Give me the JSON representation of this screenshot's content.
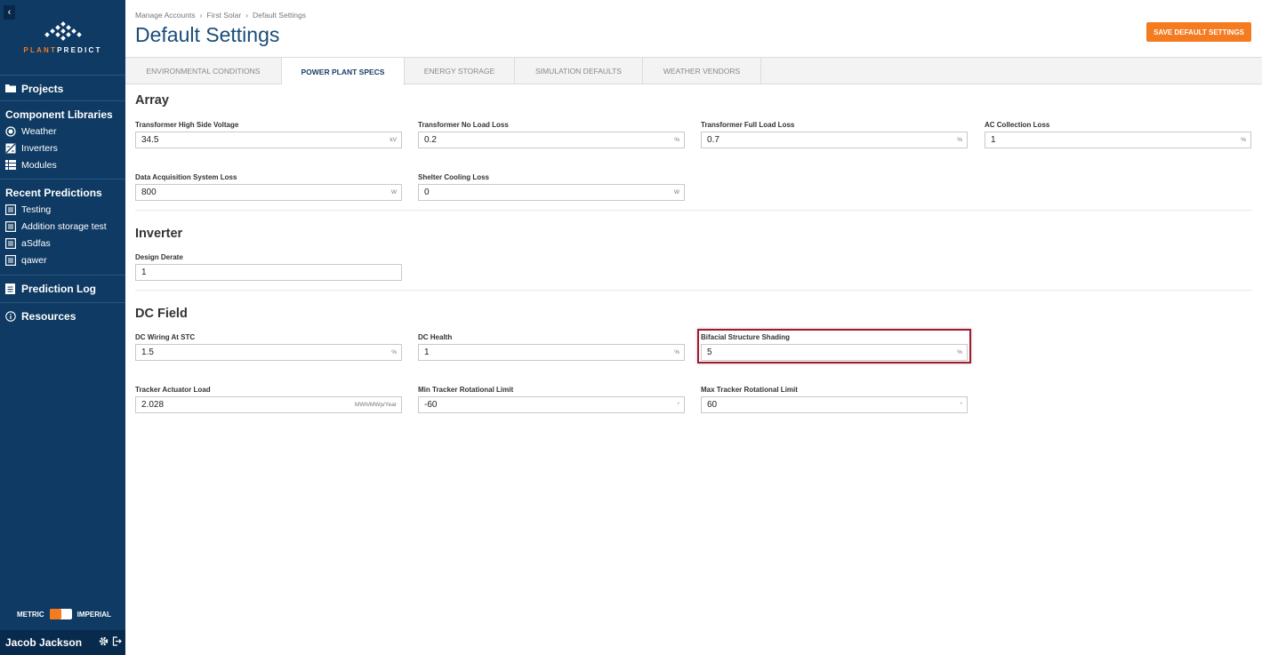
{
  "sidebar": {
    "collapse_glyph": "‹",
    "logo": {
      "plant": "PLANT",
      "predict": "PREDICT"
    },
    "projects": "Projects",
    "component_libraries": "Component Libraries",
    "libraries": [
      "Weather",
      "Inverters",
      "Modules"
    ],
    "recent_predictions": "Recent Predictions",
    "recent": [
      "Testing",
      "Addition storage test",
      "aSdfas",
      "qawer"
    ],
    "prediction_log": "Prediction Log",
    "resources": "Resources",
    "units": {
      "metric": "METRIC",
      "imperial": "IMPERIAL"
    },
    "user": "Jacob Jackson"
  },
  "header": {
    "breadcrumb": [
      "Manage Accounts",
      "First Solar",
      "Default Settings"
    ],
    "breadcrumb_sep": "›",
    "title": "Default Settings",
    "save_label": "SAVE DEFAULT SETTINGS"
  },
  "tabs": [
    "ENVIRONMENTAL CONDITIONS",
    "POWER PLANT SPECS",
    "ENERGY STORAGE",
    "SIMULATION DEFAULTS",
    "WEATHER VENDORS"
  ],
  "sections": {
    "array": "Array",
    "inverter": "Inverter",
    "dc_field": "DC Field"
  },
  "fields": {
    "thsv": {
      "label": "Transformer High Side Voltage",
      "value": "34.5",
      "unit": "kV"
    },
    "tnll": {
      "label": "Transformer No Load Loss",
      "value": "0.2",
      "unit": "%"
    },
    "tfll": {
      "label": "Transformer Full Load Loss",
      "value": "0.7",
      "unit": "%"
    },
    "acl": {
      "label": "AC Collection Loss",
      "value": "1",
      "unit": "%"
    },
    "dasl": {
      "label": "Data Acquisition System Loss",
      "value": "800",
      "unit": "W"
    },
    "scl": {
      "label": "Shelter Cooling Loss",
      "value": "0",
      "unit": "W"
    },
    "dd": {
      "label": "Design Derate",
      "value": "1",
      "unit": ""
    },
    "dcw": {
      "label": "DC Wiring At STC",
      "value": "1.5",
      "unit": "%"
    },
    "dch": {
      "label": "DC Health",
      "value": "1",
      "unit": "%"
    },
    "bss": {
      "label": "Bifacial Structure Shading",
      "value": "5",
      "unit": "%"
    },
    "tal": {
      "label": "Tracker Actuator Load",
      "value": "2.028",
      "unit": "MWh/MWp/Year"
    },
    "mintrl": {
      "label": "Min Tracker Rotational Limit",
      "value": "-60",
      "unit": "°"
    },
    "maxtrl": {
      "label": "Max Tracker Rotational Limit",
      "value": "60",
      "unit": "°"
    }
  },
  "colors": {
    "sidebar": "#0e3a63",
    "accent": "#f47b20",
    "title": "#1a4b7a",
    "highlight": "#a3192f"
  }
}
